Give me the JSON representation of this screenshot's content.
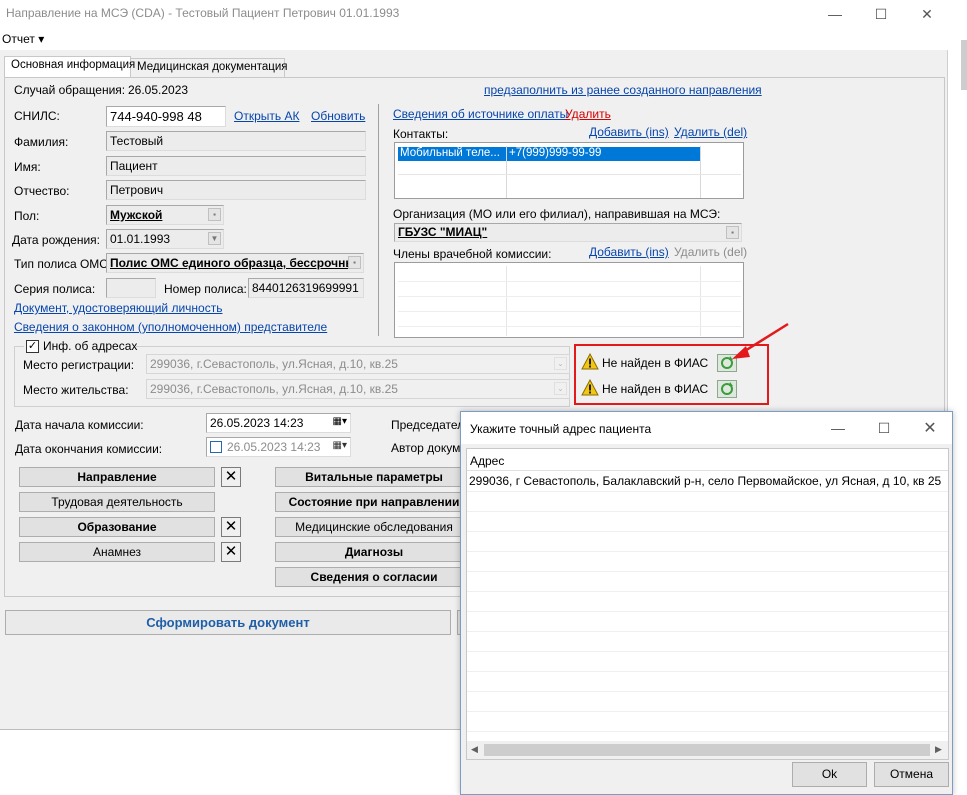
{
  "window": {
    "title": "Направление на МСЭ (CDA) - Тестовый Пациент Петрович 01.01.1993",
    "minimize_icon": "minimize-icon",
    "maximize_icon": "maximize-icon",
    "close_icon": "close-icon"
  },
  "menu": {
    "report": "Отчет ▾"
  },
  "tabs": [
    {
      "label": "Основная информация"
    },
    {
      "label": "Медицинская документация"
    }
  ],
  "case": {
    "label": "Случай обращения:",
    "date": "26.05.2023",
    "prefill_link": "предзаполнить из ранее созданного направления"
  },
  "snils": {
    "label": "СНИЛС:",
    "value": "744-940-998 48",
    "open_ak": "Открыть АК",
    "refresh": "Обновить"
  },
  "surname": {
    "label": "Фамилия:",
    "value": "Тестовый"
  },
  "name": {
    "label": "Имя:",
    "value": "Пациент"
  },
  "patronymic": {
    "label": "Отчество:",
    "value": "Петрович"
  },
  "sex": {
    "label": "Пол:",
    "value": "Мужской"
  },
  "birth": {
    "label": "Дата рождения:",
    "value": "01.01.1993"
  },
  "policy_type": {
    "label": "Тип полиса ОМС:",
    "value": "Полис ОМС единого образца, бессрочны"
  },
  "policy": {
    "series_label": "Серия полиса:",
    "series_value": "",
    "number_label": "Номер полиса:",
    "number_value": "8440126319699991"
  },
  "links": {
    "identity_doc": "Документ, удостоверяющий личность",
    "representative": "Сведения о законном (уполномоченном) представителе"
  },
  "payment": {
    "source_link": "Сведения об источнике оплаты",
    "delete_link": "Удалить"
  },
  "contacts": {
    "label": "Контакты:",
    "add": "Добавить (ins)",
    "delete": "Удалить (del)",
    "rows": [
      {
        "type": "Мобильный теле...",
        "value": "+7(999)999-99-99"
      }
    ]
  },
  "organization": {
    "label": "Организация (МО или его филиал), направившая на МСЭ:",
    "value": "ГБУЗС \"МИАЦ\""
  },
  "commission_members": {
    "label": "Члены врачебной комиссии:",
    "add": "Добавить (ins)",
    "delete": "Удалить (del)"
  },
  "address": {
    "group_label": "Инф. об адресах",
    "checked": true,
    "registration_label": "Место регистрации:",
    "registration_value": "299036, г.Севастополь, ул.Ясная, д.10, кв.25",
    "residence_label": "Место жительства:",
    "residence_value": "299036, г.Севастополь, ул.Ясная, д.10, кв.25",
    "fias_status_1": "Не найден в ФИАС",
    "fias_status_2": "Не найден в ФИАС"
  },
  "commission_dates": {
    "start_label": "Дата начала комиссии:",
    "start_value": "26.05.2023 14:23",
    "end_label": "Дата окончания комиссии:",
    "end_value": "26.05.2023 14:23",
    "chairman_label": "Председатель",
    "author_label": "Автор докуме"
  },
  "sections_left": [
    "Направление",
    "Трудовая деятельность",
    "Образование",
    "Анамнез"
  ],
  "sections_right": [
    "Витальные параметры",
    "Состояние при направлении",
    "Медицинские обследования",
    "Диагнозы",
    "Сведения о согласии"
  ],
  "generate_button": "Сформировать документ",
  "dialog": {
    "title": "Укажите точный адрес пациента",
    "column": "Адрес",
    "rows": [
      "299036, г Севастополь, Балаклавский р-н, село Первомайское, ул Ясная, д 10, кв 25"
    ],
    "ok": "Ok",
    "cancel": "Отмена"
  },
  "colors": {
    "highlight_red": "#e3191b",
    "selection_blue": "#0078d7",
    "link_blue": "#0645ad"
  }
}
